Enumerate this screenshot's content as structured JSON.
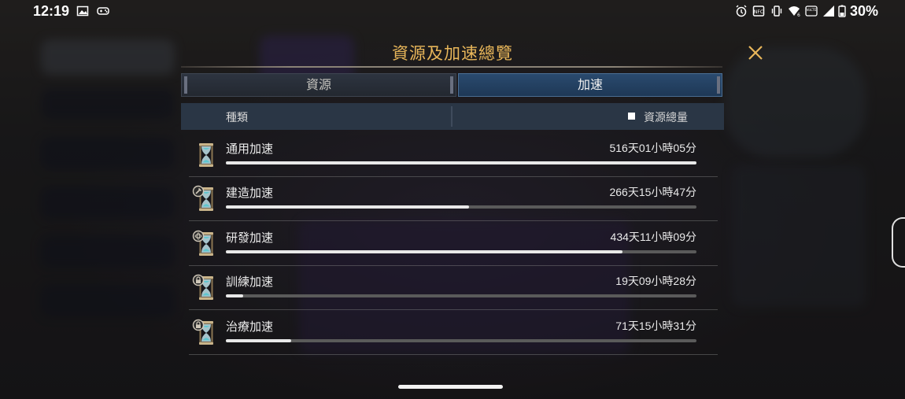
{
  "status_bar": {
    "time": "12:19",
    "battery": "30%",
    "icons": [
      "image-icon",
      "gamepad-icon",
      "alarm-icon",
      "nfc-icon",
      "vibrate-icon",
      "wifi-icon",
      "volte-icon",
      "signal-icon",
      "battery-icon"
    ]
  },
  "dialog": {
    "title": "資源及加速總覽",
    "tabs": [
      {
        "label": "資源",
        "active": false
      },
      {
        "label": "加速",
        "active": true
      }
    ],
    "header": {
      "type_label": "種類",
      "total_label": "資源總量"
    },
    "rows": [
      {
        "name": "通用加速",
        "value": "516天01小時05分",
        "progress": 1.0
      },
      {
        "name": "建造加速",
        "value": "266天15小時47分",
        "progress": 0.517
      },
      {
        "name": "研發加速",
        "value": "434天11小時09分",
        "progress": 0.843
      },
      {
        "name": "訓練加速",
        "value": "19天09小時28分",
        "progress": 0.037
      },
      {
        "name": "治療加速",
        "value": "71天15小時31分",
        "progress": 0.139
      }
    ]
  },
  "colors": {
    "title": "#e8b65a",
    "active_tab": "#2a4a6e",
    "header_bg": "#2a3645",
    "progress_fill": "#e8e8e8",
    "progress_track": "#5a5a5a"
  }
}
